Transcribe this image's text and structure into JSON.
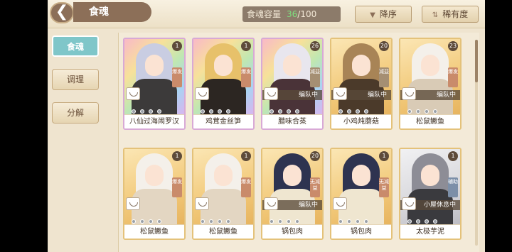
{
  "header": {
    "back_glyph": "❮",
    "title": "食魂",
    "capacity_label": "食魂容量",
    "capacity_used": "36",
    "capacity_total": "/100",
    "sort_order_label": "降序",
    "sort_order_icon": "▼",
    "sort_rarity_label": "稀有度",
    "sort_rarity_icon": "⇅"
  },
  "sidebar": {
    "items": [
      {
        "label": "食魂"
      },
      {
        "label": "调理"
      },
      {
        "label": "分解"
      }
    ]
  },
  "cards": [
    {
      "name": "八仙过海闹罗汉",
      "level": "1",
      "badge": "爆发",
      "status": "",
      "frame": "rainbow",
      "hair": "#c9cde2",
      "outfit": "#3c3a3a"
    },
    {
      "name": "鸡茸金丝笋",
      "level": "1",
      "badge": "爆发",
      "status": "",
      "frame": "rainbow",
      "hair": "#e7c16a",
      "outfit": "#2c2622"
    },
    {
      "name": "腊味合蒸",
      "level": "26",
      "badge": "减益",
      "status": "编队中",
      "frame": "rainbow",
      "hair": "#e8e6ee",
      "outfit": "#4a3338"
    },
    {
      "name": "小鸡炖蘑菇",
      "level": "20",
      "badge": "减益",
      "status": "编队中",
      "frame": "gold",
      "hair": "#a88456",
      "outfit": "#4b3a2a"
    },
    {
      "name": "松鼠鳜鱼",
      "level": "23",
      "badge": "爆发",
      "status": "编队中",
      "frame": "gold",
      "hair": "#f4f0ea",
      "outfit": "#d9cbb6"
    },
    {
      "name": "松鼠鳜鱼",
      "level": "1",
      "badge": "爆发",
      "status": "",
      "frame": "gold",
      "hair": "#f4f0ea",
      "outfit": "#e3d6c2"
    },
    {
      "name": "松鼠鳜鱼",
      "level": "1",
      "badge": "爆发",
      "status": "",
      "frame": "gold",
      "hair": "#f4f0ea",
      "outfit": "#e3d6c2"
    },
    {
      "name": "锅包肉",
      "level": "20",
      "badge": "无减益",
      "status": "编队中",
      "frame": "gold",
      "hair": "#2e3350",
      "outfit": "#efe6d0"
    },
    {
      "name": "锅包肉",
      "level": "1",
      "badge": "无减益",
      "status": "",
      "frame": "gold",
      "hair": "#2e3350",
      "outfit": "#efe6d0"
    },
    {
      "name": "太极芋泥",
      "level": "1",
      "badge": "辅助",
      "status": "小屋休息中",
      "frame": "silver",
      "hair": "#8d8d96",
      "outfit": "#3a3a3e"
    }
  ]
}
